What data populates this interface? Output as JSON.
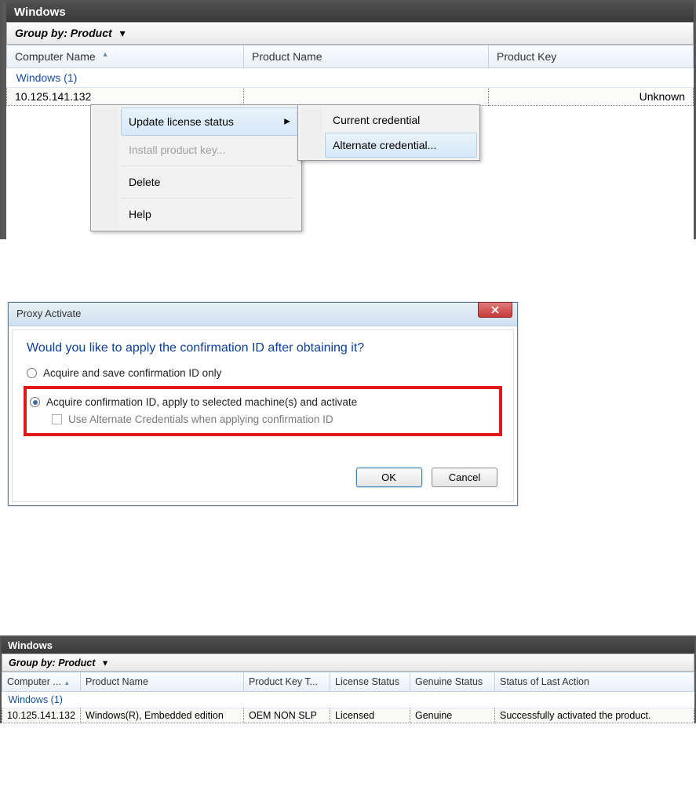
{
  "panel1": {
    "title": "Windows",
    "group_by": "Group by: Product",
    "columns": [
      "Computer Name",
      "Product Name",
      "Product Key"
    ],
    "group_row": "Windows (1)",
    "selected_row": {
      "computer": "10.125.141.132",
      "product": "",
      "key": "Unknown"
    },
    "context_menu": {
      "items": [
        {
          "label": "Update license status",
          "has_sub": true
        },
        {
          "label": "Install product key...",
          "disabled": true
        },
        {
          "label": "Delete"
        },
        {
          "label": "Help"
        }
      ],
      "submenu": [
        {
          "label": "Current credential"
        },
        {
          "label": "Alternate credential..."
        }
      ]
    }
  },
  "dialog": {
    "title": "Proxy Activate",
    "heading": "Would you like to apply the confirmation ID after obtaining it?",
    "option1": "Acquire and save confirmation ID only",
    "option2": "Acquire confirmation ID, apply to selected machine(s) and activate",
    "checkbox": "Use Alternate Credentials when applying confirmation ID",
    "ok": "OK",
    "cancel": "Cancel"
  },
  "panel3": {
    "title": "Windows",
    "group_by": "Group by: Product",
    "columns": [
      "Computer ...",
      "Product Name",
      "Product Key T...",
      "License Status",
      "Genuine Status",
      "Status of Last Action"
    ],
    "group_row": "Windows (1)",
    "row": {
      "computer": "10.125.141.132",
      "product": "Windows(R), Embedded edition",
      "keytype": "OEM NON SLP",
      "license": "Licensed",
      "genuine": "Genuine",
      "status": "Successfully activated the product."
    }
  }
}
